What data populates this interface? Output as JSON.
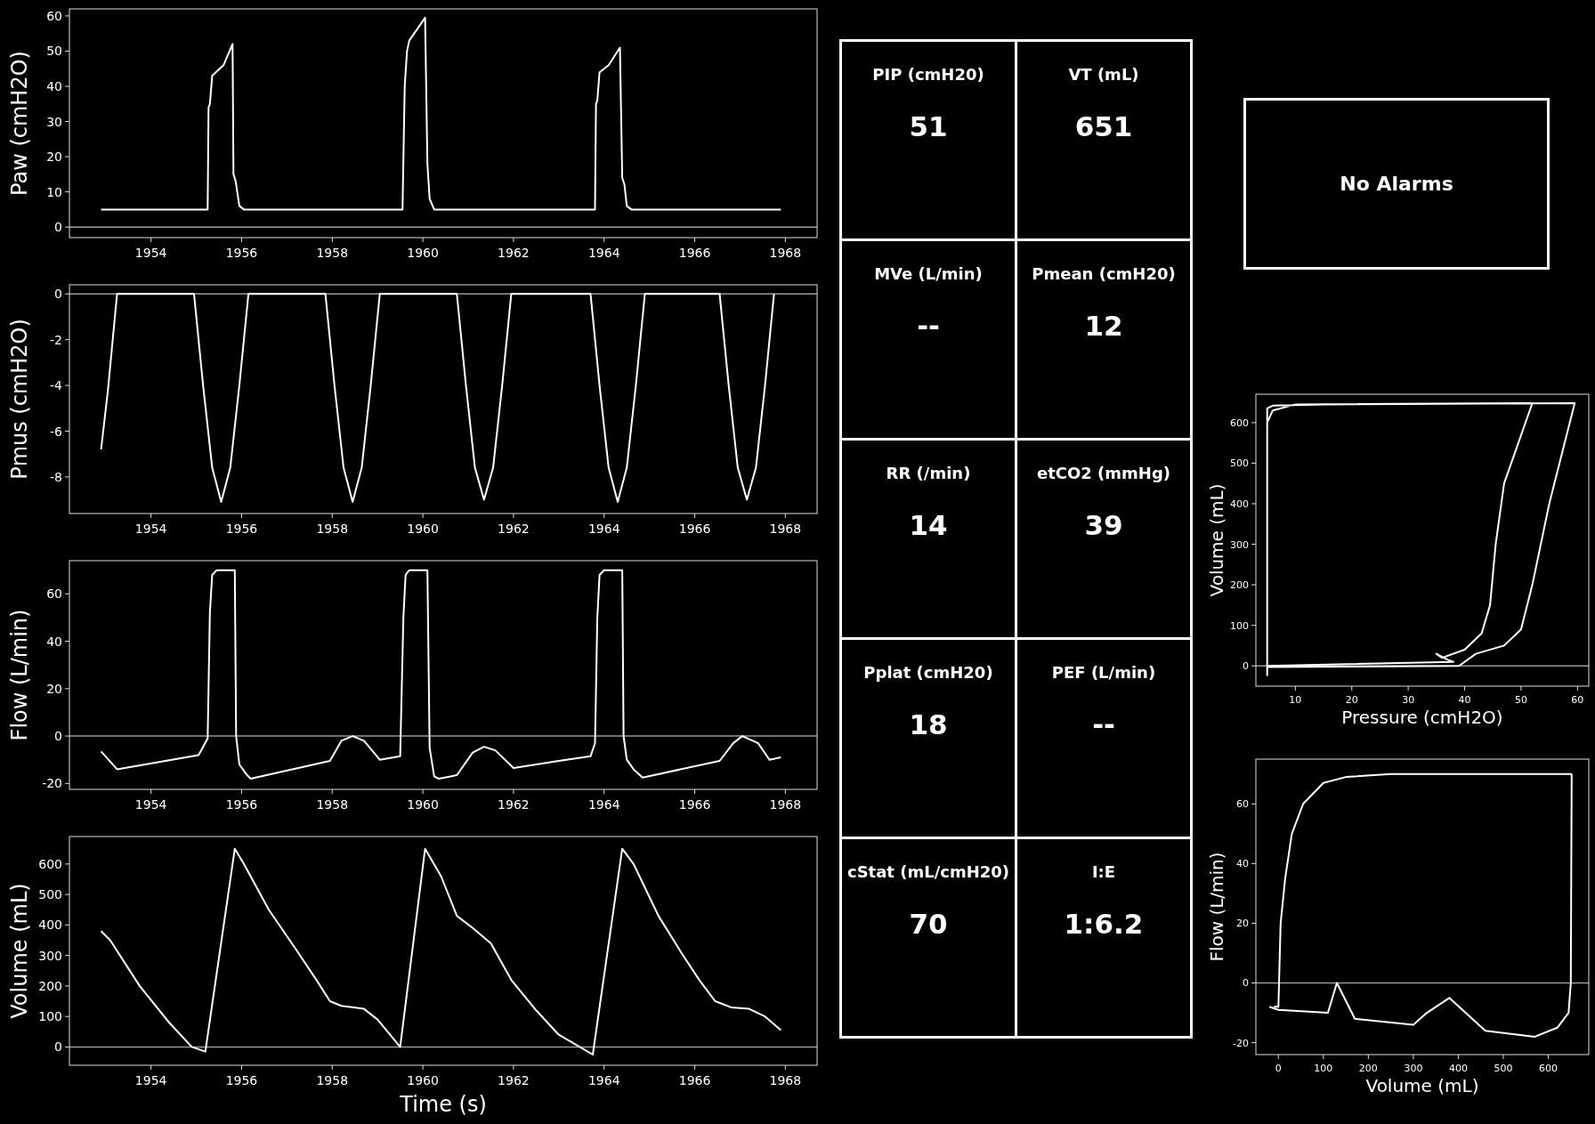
{
  "waveforms": [
    {
      "chart_data": {
        "type": "line",
        "ylabel": "Paw (cmH2O)",
        "xlim": [
          1952.2,
          1968.7
        ],
        "ylim": [
          -3,
          62
        ],
        "xticks": [
          1954,
          1956,
          1958,
          1960,
          1962,
          1964,
          1966,
          1968
        ],
        "yticks": [
          0,
          10,
          20,
          30,
          40,
          50,
          60
        ],
        "x": [
          1952.9,
          1955.25,
          1955.27,
          1955.3,
          1955.35,
          1955.6,
          1955.8,
          1955.82,
          1955.87,
          1955.95,
          1956.05,
          1959.55,
          1959.6,
          1959.65,
          1959.7,
          1960.05,
          1960.1,
          1960.15,
          1960.25,
          1963.8,
          1963.82,
          1963.85,
          1963.9,
          1964.1,
          1964.35,
          1964.4,
          1964.45,
          1964.5,
          1964.6,
          1967.9
        ],
        "series": [
          {
            "color": "#ffffff",
            "values": [
              5,
              5,
              34,
              35,
              43,
              46,
              52,
              15,
              13,
              6,
              5,
              5,
              40,
              50,
              53,
              59.5,
              18,
              8,
              5,
              5,
              35,
              36,
              44,
              46,
              51,
              14,
              12,
              6,
              5,
              5
            ]
          }
        ]
      }
    },
    {
      "chart_data": {
        "type": "line",
        "ylabel": "Pmus (cmH2O)",
        "xlim": [
          1952.2,
          1968.7
        ],
        "ylim": [
          -9.6,
          0.4
        ],
        "xticks": [
          1954,
          1956,
          1958,
          1960,
          1962,
          1964,
          1966,
          1968
        ],
        "yticks": [
          -8,
          -6,
          -4,
          -2,
          0
        ],
        "x": [
          1952.9,
          1953.05,
          1953.25,
          1954.95,
          1955.15,
          1955.35,
          1955.55,
          1955.75,
          1955.95,
          1956.15,
          1957.85,
          1958.05,
          1958.25,
          1958.45,
          1958.65,
          1958.85,
          1959.05,
          1960.75,
          1960.95,
          1961.15,
          1961.35,
          1961.55,
          1961.75,
          1961.95,
          1963.7,
          1963.9,
          1964.1,
          1964.3,
          1964.5,
          1964.7,
          1964.9,
          1966.55,
          1966.75,
          1966.95,
          1967.15,
          1967.35,
          1967.55,
          1967.75
        ],
        "series": [
          {
            "color": "#ffffff",
            "values": [
              -6.8,
              -4.2,
              0,
              0,
              -4,
              -7.6,
              -9.1,
              -7.6,
              -4,
              0,
              0,
              -4,
              -7.6,
              -9.1,
              -7.6,
              -4,
              0,
              0,
              -4,
              -7.6,
              -9,
              -7.6,
              -4,
              0,
              0,
              -4,
              -7.6,
              -9.1,
              -7.6,
              -4,
              0,
              0,
              -4,
              -7.6,
              -9,
              -7.6,
              -4,
              0
            ]
          }
        ]
      }
    },
    {
      "chart_data": {
        "type": "line",
        "ylabel": "Flow (L/min)",
        "xlim": [
          1952.2,
          1968.7
        ],
        "ylim": [
          -22.5,
          74
        ],
        "xticks": [
          1954,
          1956,
          1958,
          1960,
          1962,
          1964,
          1966,
          1968
        ],
        "yticks": [
          -20,
          0,
          20,
          40,
          60
        ],
        "x": [
          1952.9,
          1953.25,
          1955.05,
          1955.25,
          1955.3,
          1955.35,
          1955.45,
          1955.85,
          1955.88,
          1955.95,
          1956.1,
          1956.2,
          1957.95,
          1958.2,
          1958.45,
          1958.7,
          1959.05,
          1959.5,
          1959.57,
          1959.62,
          1959.7,
          1960.1,
          1960.15,
          1960.25,
          1960.35,
          1960.75,
          1961.1,
          1961.35,
          1961.6,
          1962.0,
          1963.0,
          1963.7,
          1963.8,
          1963.85,
          1963.9,
          1964.0,
          1964.4,
          1964.43,
          1964.5,
          1964.65,
          1964.85,
          1966.55,
          1966.85,
          1967.05,
          1967.4,
          1967.65,
          1967.9
        ],
        "series": [
          {
            "color": "#ffffff",
            "values": [
              -6.5,
              -14,
              -8,
              -1,
              52,
              68,
              70,
              70,
              0,
              -12,
              -16,
              -18,
              -10.5,
              -2,
              0,
              -2,
              -10,
              -8.5,
              50,
              68,
              70,
              70,
              -5,
              -17,
              -18,
              -16.5,
              -7,
              -4.5,
              -6,
              -13.5,
              -10.5,
              -8.5,
              -3,
              50,
              68,
              70,
              70,
              0,
              -10,
              -14,
              -17.5,
              -10.5,
              -3,
              0,
              -3,
              -10,
              -9
            ]
          }
        ]
      }
    },
    {
      "chart_data": {
        "type": "line",
        "xlabel": "Time (s)",
        "ylabel": "Volume (mL)",
        "xlim": [
          1952.2,
          1968.7
        ],
        "ylim": [
          -60,
          690
        ],
        "xticks": [
          1954,
          1956,
          1958,
          1960,
          1962,
          1964,
          1966,
          1968
        ],
        "yticks": [
          0,
          100,
          200,
          300,
          400,
          500,
          600
        ],
        "x": [
          1952.9,
          1953.1,
          1953.75,
          1954.4,
          1954.9,
          1955.2,
          1955.85,
          1956.05,
          1956.6,
          1957.2,
          1957.65,
          1957.95,
          1958.2,
          1958.7,
          1959.0,
          1959.5,
          1960.05,
          1960.4,
          1960.75,
          1961.1,
          1961.5,
          1961.95,
          1962.5,
          1963.0,
          1963.75,
          1964.4,
          1964.65,
          1965.2,
          1965.7,
          1966.1,
          1966.45,
          1966.8,
          1967.2,
          1967.55,
          1967.9
        ],
        "series": [
          {
            "color": "#ffffff",
            "values": [
              380,
              350,
              200,
              80,
              0,
              -15,
              650,
              600,
              450,
              320,
              220,
              150,
              135,
              125,
              90,
              0,
              650,
              560,
              430,
              390,
              340,
              220,
              120,
              40,
              -25,
              650,
              600,
              430,
              310,
              220,
              150,
              130,
              125,
              100,
              55
            ]
          }
        ]
      }
    }
  ],
  "metrics": [
    {
      "label": "PIP (cmH20)",
      "value": "51"
    },
    {
      "label": "VT (mL)",
      "value": "651"
    },
    {
      "label": "MVe (L/min)",
      "value": "--"
    },
    {
      "label": "Pmean (cmH20)",
      "value": "12"
    },
    {
      "label": "RR (/min)",
      "value": "14"
    },
    {
      "label": "etCO2 (mmHg)",
      "value": "39"
    },
    {
      "label": "Pplat (cmH20)",
      "value": "18"
    },
    {
      "label": "PEF (L/min)",
      "value": "--"
    },
    {
      "label": "cStat (mL/cmH20)",
      "value": "70"
    },
    {
      "label": "I:E",
      "value": "1:6.2"
    }
  ],
  "alarm": {
    "text": "No Alarms"
  },
  "loops": [
    {
      "chart_data": {
        "type": "line",
        "xlabel": "Pressure (cmH2O)",
        "ylabel": "Volume (mL)",
        "xlim": [
          3,
          62
        ],
        "ylim": [
          -50,
          670
        ],
        "xticks": [
          10,
          20,
          30,
          40,
          50,
          60
        ],
        "yticks": [
          0,
          100,
          200,
          300,
          400,
          500,
          600
        ],
        "x": [
          5,
          5,
          5,
          6,
          10,
          50,
          52,
          47,
          45.5,
          44.5,
          43,
          40,
          36,
          35,
          37,
          38,
          5,
          5,
          5,
          6,
          15,
          59.5,
          55,
          52,
          50,
          47,
          42,
          39,
          5
        ],
        "series": [
          {
            "color": "#ffffff",
            "values": [
              -25,
              0,
              600,
              630,
              645,
              648,
              648,
              450,
              300,
              150,
              80,
              40,
              20,
              30,
              15,
              10,
              0,
              610,
              635,
              642,
              645,
              648,
              400,
              200,
              90,
              50,
              30,
              0,
              -3
            ]
          }
        ]
      }
    },
    {
      "chart_data": {
        "type": "line",
        "xlabel": "Volume (mL)",
        "ylabel": "Flow (L/min)",
        "xlim": [
          -50,
          690
        ],
        "ylim": [
          -24,
          75
        ],
        "xticks": [
          0,
          100,
          200,
          300,
          400,
          500,
          600
        ],
        "yticks": [
          -20,
          0,
          20,
          40,
          60
        ],
        "x": [
          -20,
          -10,
          0,
          5,
          15,
          30,
          55,
          100,
          110,
          130,
          150,
          170,
          250,
          300,
          330,
          380,
          460,
          570,
          620,
          645,
          650,
          652
        ],
        "series": [
          {
            "color": "#ffffff",
            "values": [
              null,
              -8,
              -8,
              20,
              35,
              50,
              60,
              67,
              null,
              null,
              69,
              null,
              70,
              null,
              null,
              null,
              null,
              null,
              null,
              null,
              70,
              70
            ]
          },
          {
            "color": "#ffffff",
            "values": [
              -8,
              null,
              -9,
              null,
              null,
              null,
              null,
              null,
              -10,
              0,
              null,
              -12,
              null,
              -14,
              -10,
              -5,
              -16,
              -18,
              -15,
              -10,
              0,
              70
            ]
          }
        ]
      }
    }
  ]
}
